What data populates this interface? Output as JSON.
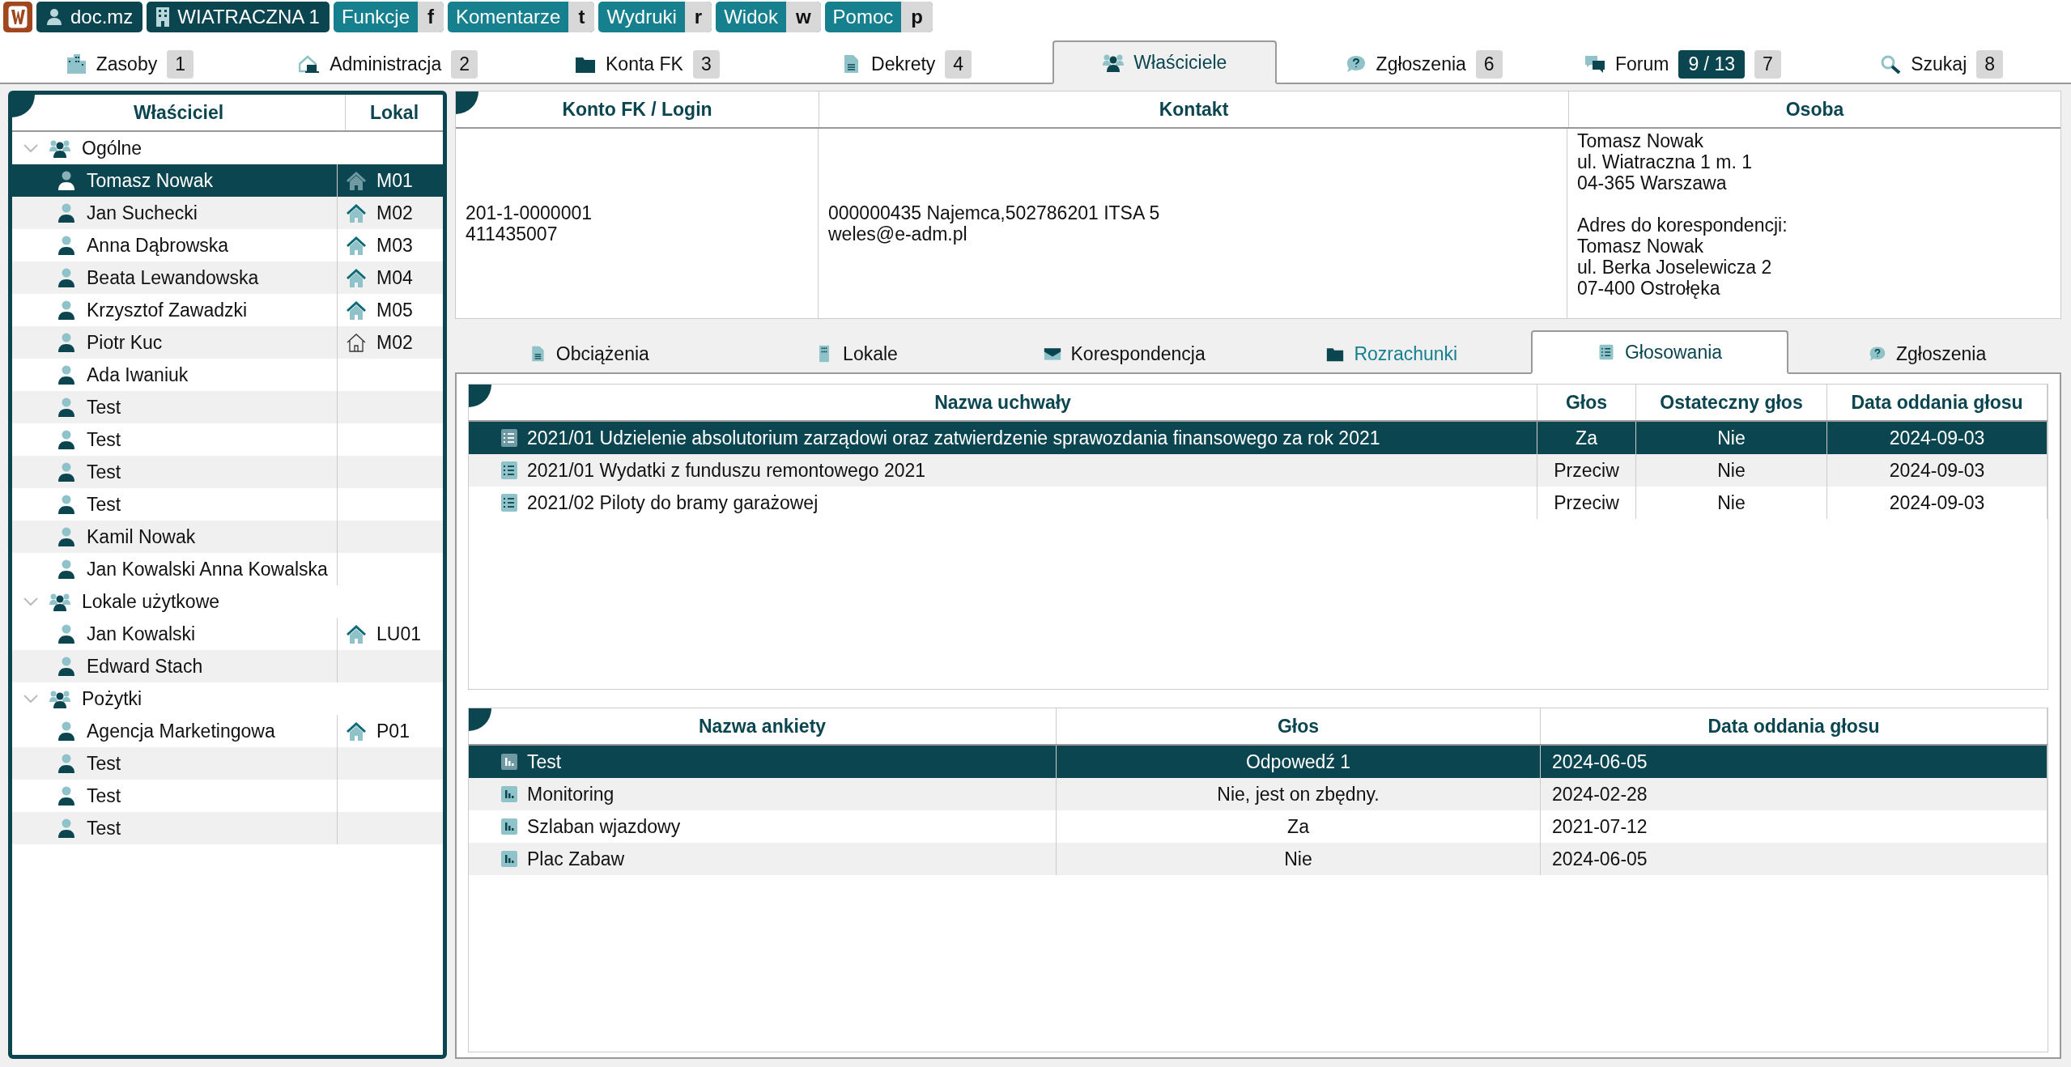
{
  "top_bar": {
    "buttons": [
      {
        "kind": "logo"
      },
      {
        "kind": "user",
        "label": "doc.mz"
      },
      {
        "kind": "building",
        "label": "WIATRACZNA 1"
      }
    ],
    "menus": [
      {
        "label": "Funkcje",
        "key": "f"
      },
      {
        "label": "Komentarze",
        "key": "t"
      },
      {
        "label": "Wydruki",
        "key": "r"
      },
      {
        "label": "Widok",
        "key": "w"
      },
      {
        "label": "Pomoc",
        "key": "p"
      }
    ]
  },
  "tabs": [
    {
      "label": "Zasoby",
      "key": "1",
      "selected": false
    },
    {
      "label": "Administracja",
      "key": "2",
      "selected": false
    },
    {
      "label": "Konta FK",
      "key": "3",
      "selected": false
    },
    {
      "label": "Dekrety",
      "key": "4",
      "selected": false
    },
    {
      "label": "Właściciele",
      "selected": true
    },
    {
      "label": "Zgłoszenia",
      "key": "6",
      "selected": false
    },
    {
      "label": "Forum",
      "counter": "9 / 13",
      "key": "7",
      "selected": false
    },
    {
      "label": "Szukaj",
      "key": "8",
      "selected": false
    }
  ],
  "owners": {
    "columns": [
      "Właściciel",
      "Lokal"
    ],
    "groups": [
      {
        "name": "Ogólne",
        "expanded": true,
        "children": [
          {
            "name": "Tomasz Nowak",
            "unit": "M01",
            "unit_active": true,
            "selected": true
          },
          {
            "name": "Jan Suchecki",
            "unit": "M02",
            "unit_active": true,
            "selected": false
          },
          {
            "name": "Anna Dąbrowska",
            "unit": "M03",
            "unit_active": true,
            "selected": false
          },
          {
            "name": "Beata Lewandowska",
            "unit": "M04",
            "unit_active": true,
            "selected": false
          },
          {
            "name": "Krzysztof Zawadzki",
            "unit": "M05",
            "unit_active": true,
            "selected": false
          },
          {
            "name": "Piotr Kuc",
            "unit": "M02",
            "unit_active": false,
            "selected": false
          },
          {
            "name": "Ada Iwaniuk",
            "selected": false
          },
          {
            "name": "Test",
            "selected": false
          },
          {
            "name": "Test",
            "selected": false
          },
          {
            "name": "Test",
            "selected": false
          },
          {
            "name": "Test",
            "selected": false
          },
          {
            "name": "Kamil Nowak",
            "selected": false
          },
          {
            "name": "Jan Kowalski Anna Kowalska",
            "selected": false
          }
        ]
      },
      {
        "name": "Lokale użytkowe",
        "expanded": true,
        "children": [
          {
            "name": "Jan Kowalski",
            "unit": "LU01",
            "unit_active": true,
            "selected": false
          },
          {
            "name": "Edward Stach",
            "selected": false
          }
        ]
      },
      {
        "name": "Pożytki",
        "expanded": true,
        "children": [
          {
            "name": "Agencja Marketingowa",
            "unit": "P01",
            "unit_active": true,
            "selected": false
          },
          {
            "name": "Test",
            "selected": false
          },
          {
            "name": "Test",
            "selected": false
          },
          {
            "name": "Test",
            "selected": false
          }
        ]
      }
    ]
  },
  "details": {
    "columns": [
      "Konto FK / Login",
      "Kontakt",
      "Osoba"
    ],
    "account": [
      "201-1-0000001",
      "411435007"
    ],
    "contact": [
      "000000435 Najemca,502786201 ITSA 5",
      "weles@e-adm.pl"
    ],
    "person": [
      "Tomasz Nowak",
      "ul. Wiatraczna 1 m. 1",
      "04-365 Warszawa"
    ],
    "correspondence": [
      "Adres do korespondencji:",
      "Tomasz Nowak",
      "ul. Berka Joselewicza 2",
      "07-400 Ostrołęka"
    ]
  },
  "sub_tabs": [
    {
      "label": "Obciążenia",
      "selected": false,
      "highlighted": false
    },
    {
      "label": "Lokale",
      "selected": false,
      "highlighted": false
    },
    {
      "label": "Korespondencja",
      "selected": false,
      "highlighted": false
    },
    {
      "label": "Rozrachunki",
      "selected": false,
      "highlighted": true
    },
    {
      "label": "Głosowania",
      "selected": true,
      "highlighted": false
    },
    {
      "label": "Zgłoszenia",
      "selected": false,
      "highlighted": false
    }
  ],
  "resolutions": {
    "columns": [
      "Nazwa uchwały",
      "Głos",
      "Ostateczny głos",
      "Data oddania głosu"
    ],
    "rows": [
      {
        "name": "2021/01 Udzielenie absolutorium zarządowi oraz zatwierdzenie sprawozdania finansowego za rok 2021",
        "vote": "Za",
        "final": "Nie",
        "date": "2024-09-03",
        "selected": true
      },
      {
        "name": "2021/01 Wydatki z funduszu remontowego 2021",
        "vote": "Przeciw",
        "final": "Nie",
        "date": "2024-09-03",
        "selected": false
      },
      {
        "name": "2021/02 Piloty do bramy garażowej",
        "vote": "Przeciw",
        "final": "Nie",
        "date": "2024-09-03",
        "selected": false
      }
    ]
  },
  "surveys": {
    "columns": [
      "Nazwa ankiety",
      "Głos",
      "Data oddania głosu"
    ],
    "rows": [
      {
        "name": "Test",
        "vote": "Odpowedź 1",
        "date": "2024-06-05",
        "selected": true
      },
      {
        "name": "Monitoring",
        "vote": "Nie, jest on zbędny.",
        "date": "2024-02-28",
        "selected": false
      },
      {
        "name": "Szlaban wjazdowy",
        "vote": "Za",
        "date": "2021-07-12",
        "selected": false
      },
      {
        "name": "Plac Zabaw",
        "vote": "Nie",
        "date": "2024-06-05",
        "selected": false
      }
    ]
  }
}
